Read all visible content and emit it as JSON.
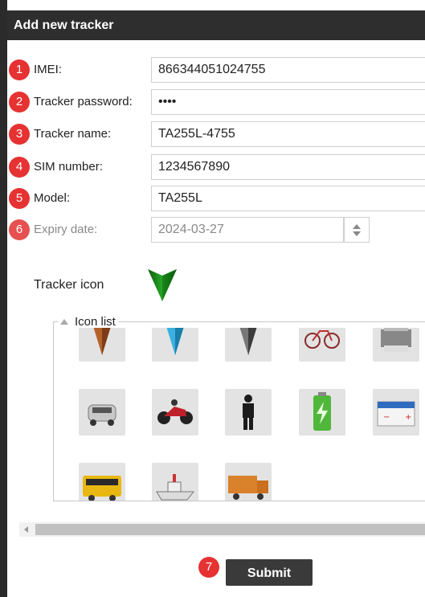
{
  "window": {
    "title": "Add new tracker"
  },
  "form": {
    "fields": [
      {
        "badge": "1",
        "label": "IMEI:",
        "value": "866344051024755"
      },
      {
        "badge": "2",
        "label": "Tracker password:",
        "value": "••••"
      },
      {
        "badge": "3",
        "label": "Tracker name:",
        "value": "TA255L-4755"
      },
      {
        "badge": "4",
        "label": "SIM number:",
        "value": "1234567890"
      },
      {
        "badge": "5",
        "label": "Model:",
        "value": "TA255L"
      },
      {
        "badge": "6",
        "label": "Expiry date:",
        "value": "2024-03-27"
      }
    ]
  },
  "tracker_icon": {
    "label": "Tracker icon",
    "color": "#1a8a1a"
  },
  "icon_list": {
    "legend": "Icon list",
    "icons": [
      "orange-arrow-icon",
      "blue-arrow-icon",
      "gray-arrow-icon",
      "bicycle-icon",
      "printer-icon",
      "car-icon",
      "motorcycle-icon",
      "person-icon",
      "battery-icon",
      "car-battery-icon",
      "school-bus-icon",
      "boat-icon",
      "truck-icon"
    ]
  },
  "submit": {
    "badge": "7",
    "label": "Submit"
  },
  "colors": {
    "badge": "#e63232",
    "titlebar": "#2e2e2e",
    "submit": "#3a3a3a"
  }
}
